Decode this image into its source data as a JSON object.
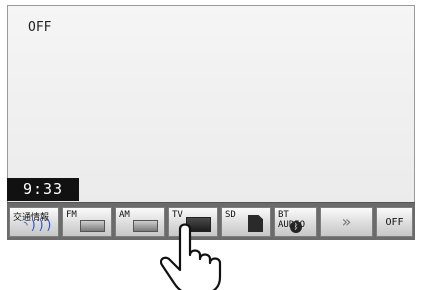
{
  "screen": {
    "status_text": "OFF",
    "clock": "9:33"
  },
  "source_bar": {
    "buttons": [
      {
        "label": "交通情報",
        "icon": "traffic-info-waves-icon"
      },
      {
        "label": "FM",
        "icon": "fm-tuner-icon"
      },
      {
        "label": "AM",
        "icon": "am-tuner-icon"
      },
      {
        "label": "TV",
        "icon": "tv-icon"
      },
      {
        "label": "SD",
        "icon": "sd-card-icon"
      },
      {
        "label": "BT AUDIO",
        "icon": "bluetooth-icon"
      },
      {
        "label": "",
        "icon": "double-chevron-right-icon",
        "glyph": "»"
      },
      {
        "label": "OFF",
        "icon": ""
      }
    ]
  },
  "overlay": {
    "icon": "pointing-hand-icon"
  }
}
